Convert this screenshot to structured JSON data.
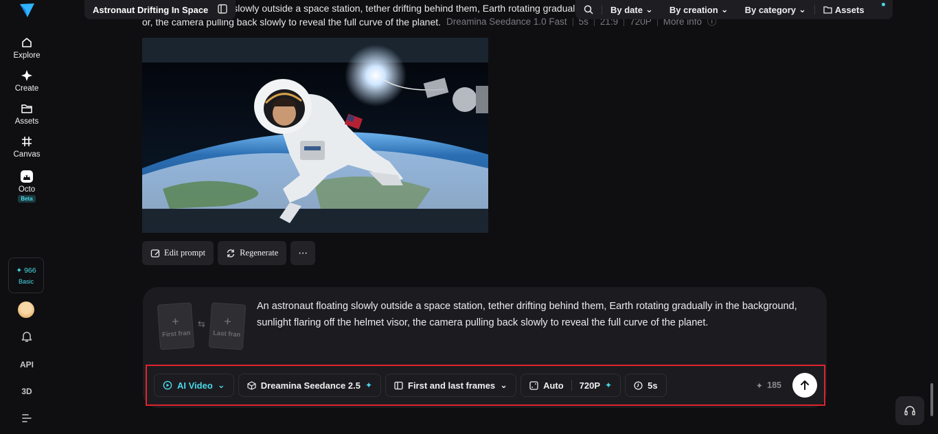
{
  "sidebar": {
    "nav": [
      {
        "label": "Explore",
        "icon": "home-icon"
      },
      {
        "label": "Create",
        "icon": "sparkle-icon"
      },
      {
        "label": "Assets",
        "icon": "folder-icon"
      },
      {
        "label": "Canvas",
        "icon": "grid-icon"
      },
      {
        "label": "Octo",
        "icon": "octo-icon",
        "badge": "Beta"
      }
    ],
    "credits": {
      "amount": "966",
      "plan": "Basic"
    },
    "bottom": {
      "api": "API",
      "three_d": "3D"
    }
  },
  "header": {
    "title": "Astronaut Drifting In Space",
    "filters": [
      {
        "label": "By date"
      },
      {
        "label": "By creation"
      },
      {
        "label": "By category"
      }
    ],
    "assets_label": "Assets"
  },
  "generation": {
    "prompt_line1": "An astronaut floating slowly outside a space station, tether drifting behind them, Earth rotating gradually in the background, sunlight flaring off the helmet visor,",
    "prompt_line2": "or, the camera pulling back slowly to reveal the full curve of the planet.",
    "model": "Dreamina Seedance 1.0 Fast",
    "duration": "5s",
    "ratio": "21:9",
    "resolution": "720P",
    "more_info": "More info"
  },
  "actions": {
    "edit": "Edit prompt",
    "regenerate": "Regenerate"
  },
  "composer": {
    "first_frame": "First fran",
    "last_frame": "Last fran",
    "prompt": "An astronaut floating slowly outside a space station, tether drifting behind them, Earth rotating gradually in the background, sunlight flaring off the helmet visor, the camera pulling back slowly to reveal the full curve of the planet.",
    "mode": "AI Video",
    "model": "Dreamina Seedance 2.5",
    "frames_mode": "First and last frames",
    "ratio": "Auto",
    "resolution": "720P",
    "duration": "5s",
    "cost": "185"
  },
  "colors": {
    "accent": "#49d9e9",
    "highlight": "#e0242e",
    "background": "#0f0f11"
  }
}
